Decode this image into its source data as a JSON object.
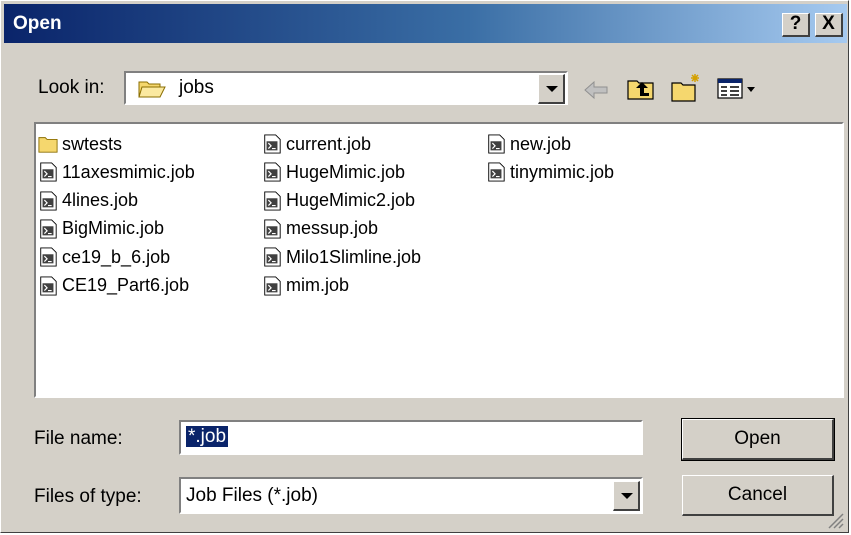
{
  "window": {
    "title": "Open",
    "help_label": "?",
    "close_label": "X"
  },
  "look_in": {
    "label": "Look in:",
    "value": "jobs",
    "folder_icon": "folder-open-icon"
  },
  "toolbar": {
    "icons": [
      "back-arrow-icon",
      "up-one-level-icon",
      "new-folder-icon",
      "view-menu-icon"
    ]
  },
  "file_list": {
    "columns": [
      [
        {
          "name": "swtests",
          "icon": "folder-icon"
        },
        {
          "name": "11axesmimic.job",
          "icon": "job-file-icon"
        },
        {
          "name": "4lines.job",
          "icon": "job-file-icon"
        },
        {
          "name": "BigMimic.job",
          "icon": "job-file-icon"
        },
        {
          "name": "ce19_b_6.job",
          "icon": "job-file-icon"
        },
        {
          "name": "CE19_Part6.job",
          "icon": "job-file-icon"
        }
      ],
      [
        {
          "name": "current.job",
          "icon": "job-file-icon"
        },
        {
          "name": "HugeMimic.job",
          "icon": "job-file-icon"
        },
        {
          "name": "HugeMimic2.job",
          "icon": "job-file-icon"
        },
        {
          "name": "messup.job",
          "icon": "job-file-icon"
        },
        {
          "name": "Milo1Slimline.job",
          "icon": "job-file-icon"
        },
        {
          "name": "mim.job",
          "icon": "job-file-icon"
        }
      ],
      [
        {
          "name": "new.job",
          "icon": "job-file-icon"
        },
        {
          "name": "tinymimic.job",
          "icon": "job-file-icon"
        }
      ]
    ]
  },
  "file_name": {
    "label": "File name:",
    "value": "*.job"
  },
  "file_type": {
    "label": "Files of type:",
    "value": "Job Files (*.job)"
  },
  "buttons": {
    "open": "Open",
    "cancel": "Cancel"
  },
  "colors": {
    "title_start": "#0a246a",
    "title_end": "#a6caf0",
    "face": "#d4d0c8",
    "selection": "#0a246a"
  }
}
